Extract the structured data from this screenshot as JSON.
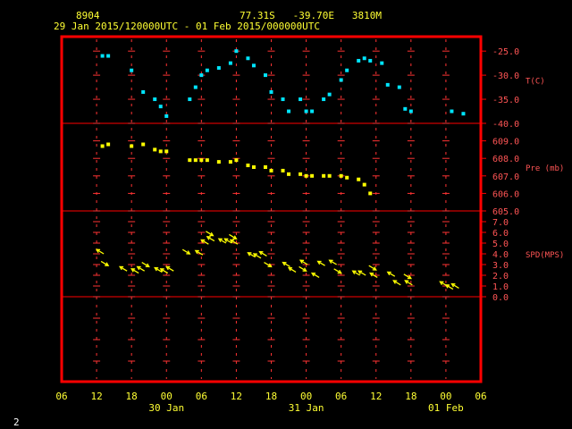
{
  "header": {
    "station": "8904",
    "location": "77.31S   -39.70E   3810M",
    "period": "29 Jan 2015/120000UTC - 01 Feb 2015/000000UTC"
  },
  "footer": {
    "page_number": "2"
  },
  "chart_data": {
    "type": "scatter",
    "x_axis": {
      "unit": "hours since 29 Jan 2015 00UTC",
      "range": [
        6,
        78
      ],
      "ticks": [
        6,
        12,
        18,
        24,
        30,
        36,
        42,
        48,
        54,
        60,
        66,
        72,
        78
      ],
      "tick_labels": [
        "06",
        "12",
        "18",
        "00",
        "06",
        "12",
        "18",
        "00",
        "06",
        "12",
        "18",
        "00",
        "06"
      ],
      "date_labels": [
        {
          "x": 24,
          "label": "30 Jan"
        },
        {
          "x": 48,
          "label": "31 Jan"
        },
        {
          "x": 72,
          "label": "01 Feb"
        }
      ]
    },
    "panels": [
      {
        "name": "temperature",
        "label": "T(C)",
        "color": "#00e5ff",
        "ylim": [
          -40.0,
          -22.0
        ],
        "ticks": [
          -25.0,
          -30.0,
          -35.0,
          -40.0
        ],
        "tick_labels": [
          "-25.0",
          "-30.0",
          "-35.0",
          "-40.0"
        ],
        "x": [
          13,
          14,
          18,
          20,
          22,
          23,
          24,
          28,
          29,
          30,
          31,
          33,
          35,
          36,
          38,
          39,
          41,
          42,
          44,
          45,
          47,
          48,
          49,
          51,
          52,
          54,
          55,
          57,
          58,
          59,
          61,
          62,
          64,
          65,
          66,
          73,
          75
        ],
        "values": [
          -26.0,
          -26.0,
          -29.0,
          -33.5,
          -35.0,
          -36.5,
          -38.5,
          -35.0,
          -32.5,
          -30.0,
          -29.0,
          -28.5,
          -27.5,
          -25.0,
          -26.5,
          -28.0,
          -30.0,
          -33.5,
          -35.0,
          -37.5,
          -35.0,
          -37.5,
          -37.5,
          -35.0,
          -34.0,
          -31.0,
          -29.0,
          -27.0,
          -26.5,
          -27.0,
          -27.5,
          -32.0,
          -32.5,
          -37.0,
          -37.5,
          -37.5,
          -38.0
        ]
      },
      {
        "name": "pressure",
        "label": "Pre (mb)",
        "color": "#ffff00",
        "ylim": [
          605.0,
          610.0
        ],
        "ticks": [
          609.0,
          608.0,
          607.0,
          606.0,
          605.0
        ],
        "tick_labels": [
          "609.0",
          "608.0",
          "607.0",
          "606.0",
          "605.0"
        ],
        "x": [
          13,
          14,
          18,
          20,
          22,
          23,
          24,
          28,
          29,
          30,
          31,
          33,
          35,
          36,
          38,
          39,
          41,
          42,
          44,
          45,
          47,
          48,
          49,
          51,
          52,
          54,
          55,
          57,
          58,
          59,
          61,
          62,
          64,
          65,
          66,
          73,
          75
        ],
        "values": [
          608.7,
          608.8,
          608.7,
          608.8,
          608.5,
          608.4,
          608.4,
          607.9,
          607.9,
          607.9,
          607.9,
          607.8,
          607.8,
          607.9,
          607.6,
          607.5,
          607.5,
          607.3,
          607.3,
          607.1,
          607.1,
          607.0,
          607.0,
          607.0,
          607.0,
          607.0,
          606.9,
          606.8,
          606.5,
          606.0
        ]
      },
      {
        "name": "wind_speed",
        "label": "SPD(MPS)",
        "color": "#ffff00",
        "ylim": [
          0.0,
          8.0
        ],
        "ticks": [
          7.0,
          6.0,
          5.0,
          4.0,
          3.0,
          2.0,
          1.0,
          0.0
        ],
        "tick_labels": [
          "7.0",
          "6.0",
          "5.0",
          "4.0",
          "3.0",
          "2.0",
          "1.0",
          "0.0"
        ],
        "x": [
          12,
          14,
          16,
          18,
          19,
          21,
          22,
          23,
          24,
          28,
          29,
          30,
          31,
          32,
          33,
          34,
          35,
          36,
          38,
          39,
          40,
          42,
          44,
          45,
          47,
          48,
          49,
          50,
          52,
          54,
          56,
          57,
          59,
          60,
          62,
          63,
          65,
          66,
          71,
          72,
          73
        ],
        "values": [
          4.4,
          2.9,
          2.8,
          2.6,
          2.8,
          2.8,
          2.7,
          2.6,
          2.8,
          4.0,
          4.3,
          5.3,
          5.6,
          5.7,
          5.4,
          5.4,
          5.3,
          5.4,
          4.1,
          4.0,
          4.2,
          2.8,
          3.2,
          2.7,
          3.4,
          2.4,
          2.2,
          3.3,
          3.4,
          2.2,
          2.4,
          2.4,
          2.2,
          2.5,
          2.3,
          1.5,
          1.5,
          1.7,
          1.4,
          1.1,
          1.2
        ]
      }
    ],
    "grid": true
  }
}
